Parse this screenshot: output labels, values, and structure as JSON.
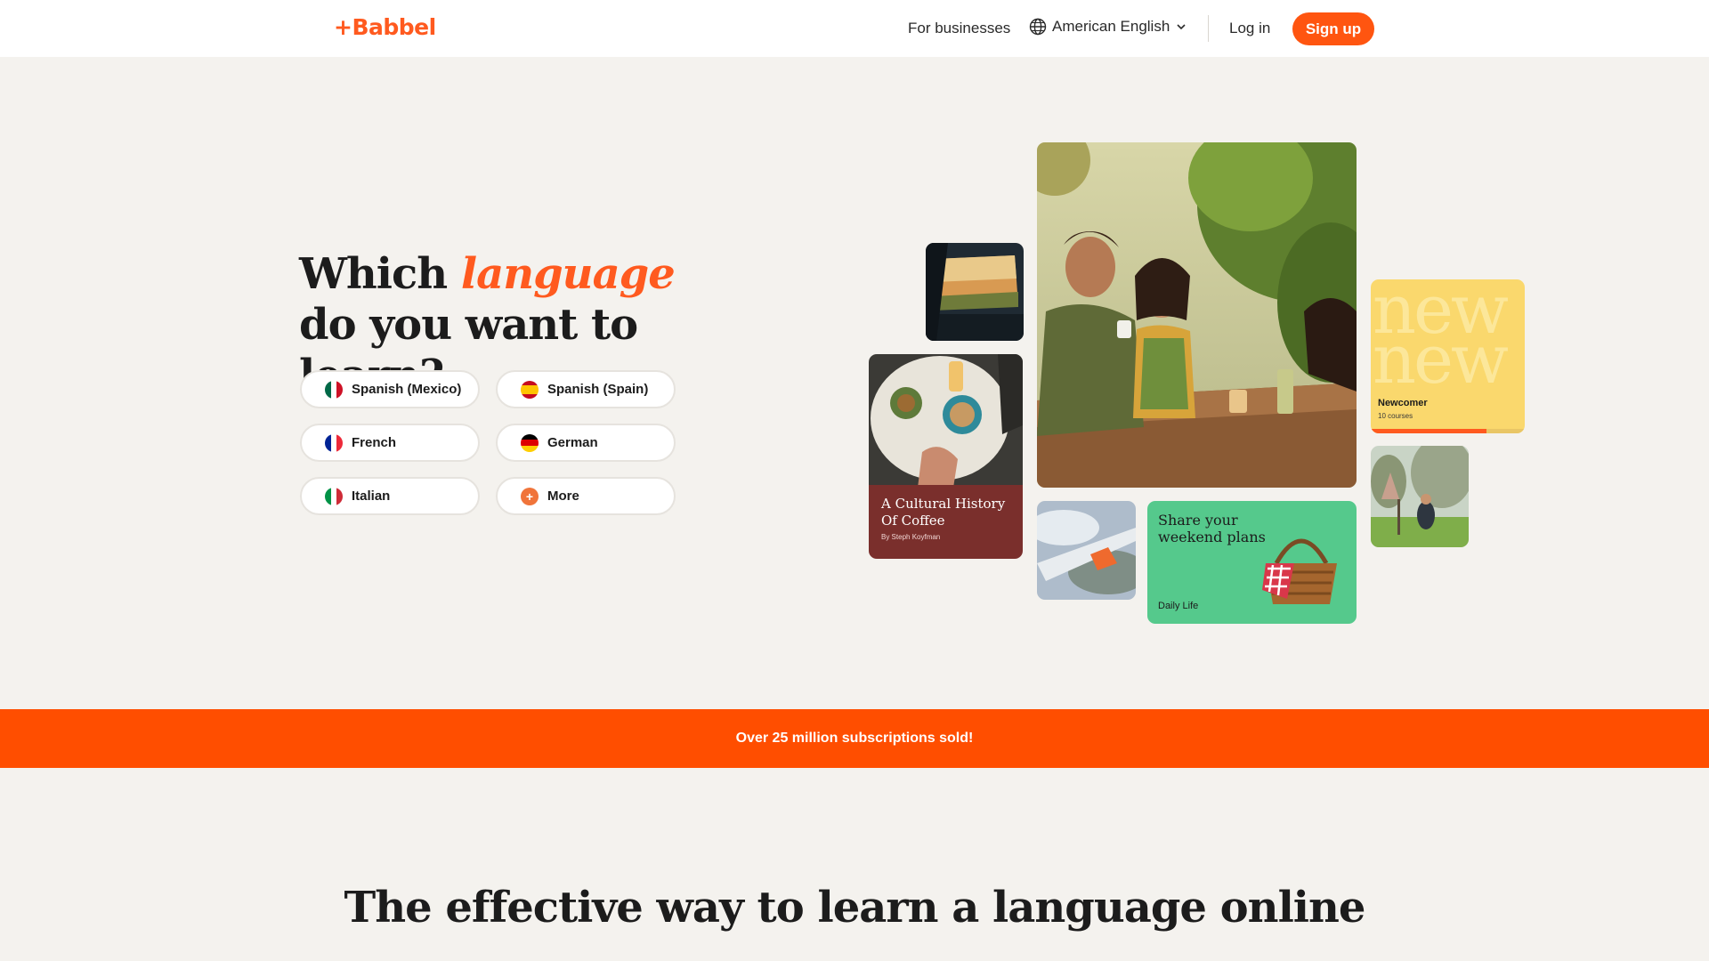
{
  "header": {
    "logo": "+Babbel",
    "for_businesses": "For businesses",
    "language": "American English",
    "login": "Log in",
    "signup": "Sign up"
  },
  "hero": {
    "title_part1": "Which ",
    "title_accent": "language",
    "title_part2": " do you want to learn?",
    "languages": [
      {
        "label": "Spanish (Mexico)",
        "flag": "mexico"
      },
      {
        "label": "Spanish (Spain)",
        "flag": "spain"
      },
      {
        "label": "French",
        "flag": "france"
      },
      {
        "label": "German",
        "flag": "germany"
      },
      {
        "label": "Italian",
        "flag": "italy"
      },
      {
        "label": "More",
        "flag": "more"
      }
    ]
  },
  "cards": {
    "coffee_title": "A Cultural History Of Coffee",
    "coffee_author": "By Steph Koyfman",
    "newcomer_label": "Newcomer",
    "newcomer_sub": "10 courses",
    "newcomer_word": "new",
    "newcomer_progress": 0.75,
    "share_title": "Share your weekend plans",
    "share_sub": "Daily Life"
  },
  "banner": {
    "text": "Over 25 million subscriptions sold!"
  },
  "section": {
    "title": "The effective way to learn a language online"
  },
  "colors": {
    "accent": "#ff5a1f",
    "banner": "#ff4e00",
    "background": "#f4f2ee"
  }
}
